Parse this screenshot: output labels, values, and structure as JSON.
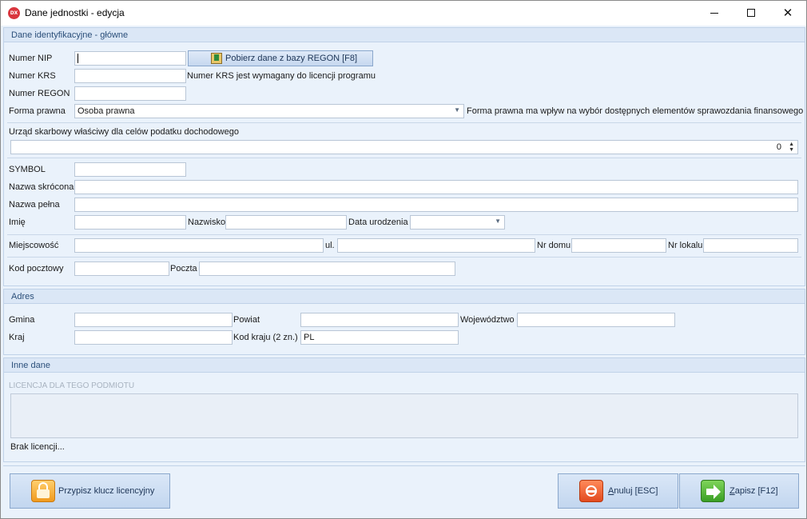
{
  "window": {
    "app_icon_text": "DX",
    "title": "Dane jednostki - edycja",
    "minimize": "–",
    "maximize": "□",
    "close": "✕"
  },
  "group_main": {
    "title": "Dane identyfikacyjne - główne",
    "nip_label": "Numer NIP",
    "nip_value": "",
    "regon_button": "Pobierz dane z bazy REGON [F8]",
    "krs_label": "Numer KRS",
    "krs_value": "",
    "krs_note": "Numer KRS jest wymagany do licencji programu",
    "regon_label": "Numer REGON",
    "regon_value": "",
    "forma_label": "Forma prawna",
    "forma_value": "Osoba prawna",
    "forma_note": "Forma prawna ma wpływ na wybór dostępnych elementów sprawozdania finansowego",
    "urzad_label": "Urząd skarbowy właściwy dla celów podatku dochodowego",
    "urzad_value": "0",
    "symbol_label": "SYMBOL",
    "symbol_value": "",
    "nazwa_skrocona_label": "Nazwa skrócona",
    "nazwa_skrocona_value": "",
    "nazwa_pelna_label": "Nazwa pełna",
    "nazwa_pelna_value": "",
    "imie_label": "Imię",
    "imie_value": "",
    "nazwisko_label": "Nazwisko",
    "nazwisko_value": "",
    "data_urodzenia_label": "Data urodzenia",
    "data_urodzenia_value": "",
    "miejscowosc_label": "Miejscowość",
    "miejscowosc_value": "",
    "ulica_label": "ul.",
    "ulica_value": "",
    "nr_domu_label": "Nr domu",
    "nr_domu_value": "",
    "nr_lokalu_label": "Nr lokalu",
    "nr_lokalu_value": "",
    "kod_pocztowy_label": "Kod pocztowy",
    "kod_pocztowy_value": "",
    "poczta_label": "Poczta",
    "poczta_value": ""
  },
  "group_adres": {
    "title": "Adres",
    "gmina_label": "Gmina",
    "gmina_value": "",
    "powiat_label": "Powiat",
    "powiat_value": "",
    "wojewodztwo_label": "Województwo",
    "wojewodztwo_value": "",
    "kraj_label": "Kraj",
    "kraj_value": "",
    "kod_kraju_label": "Kod kraju (2 zn.)",
    "kod_kraju_value": "PL"
  },
  "group_inne": {
    "title": "Inne dane",
    "licencja_title": "LICENCJA DLA TEGO PODMIOTU",
    "brak_licencji": "Brak licencji..."
  },
  "footer": {
    "assign_key_button": "Przypisz klucz licencyjny",
    "cancel_button_accel": "A",
    "cancel_button_rest": "nuluj [ESC]",
    "save_button_accel": "Z",
    "save_button_rest": "apisz [F12]"
  },
  "colors": {
    "group_title": "#2b4f7a",
    "panel_bg": "#eaf2fb",
    "header_bg": "#dbe7f6",
    "app_icon": "#d9363e"
  }
}
